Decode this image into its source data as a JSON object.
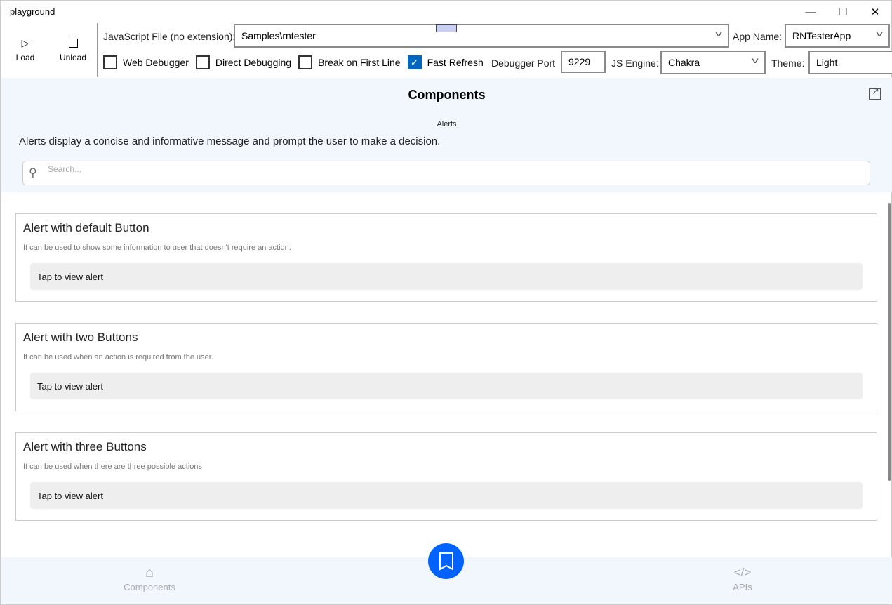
{
  "window": {
    "title": "playground"
  },
  "toolbar": {
    "load": "Load",
    "unload": "Unload",
    "js_file_label": "JavaScript File (no extension):",
    "js_file_value": "Samples\\rntester",
    "app_name_label": "App Name:",
    "app_name_value": "RNTesterApp",
    "web_debugger": "Web Debugger",
    "direct_debugging": "Direct Debugging",
    "break_first_line": "Break on First Line",
    "fast_refresh": "Fast Refresh",
    "fast_refresh_checked": true,
    "debugger_port_label": "Debugger Port",
    "debugger_port_value": "9229",
    "js_engine_label": "JS Engine:",
    "js_engine_value": "Chakra",
    "theme_label": "Theme:",
    "theme_value": "Light"
  },
  "header": {
    "title": "Components",
    "subtitle": "Alerts",
    "description": "Alerts display a concise and informative message and prompt the user to make a decision.",
    "search_placeholder": "Search..."
  },
  "examples": [
    {
      "title": "Alert with default Button",
      "description": "It can be used to show some information to user that doesn't require an action.",
      "button": "Tap to view alert"
    },
    {
      "title": "Alert with two Buttons",
      "description": "It can be used when an action is required from the user.",
      "button": "Tap to view alert"
    },
    {
      "title": "Alert with three Buttons",
      "description": "It can be used when there are three possible actions",
      "button": "Tap to view alert"
    }
  ],
  "nav": {
    "components": "Components",
    "apis": "APIs"
  },
  "colors": {
    "accent": "#0062ff",
    "header_bg": "#f2f7fe",
    "checkbox": "#0067c0"
  }
}
